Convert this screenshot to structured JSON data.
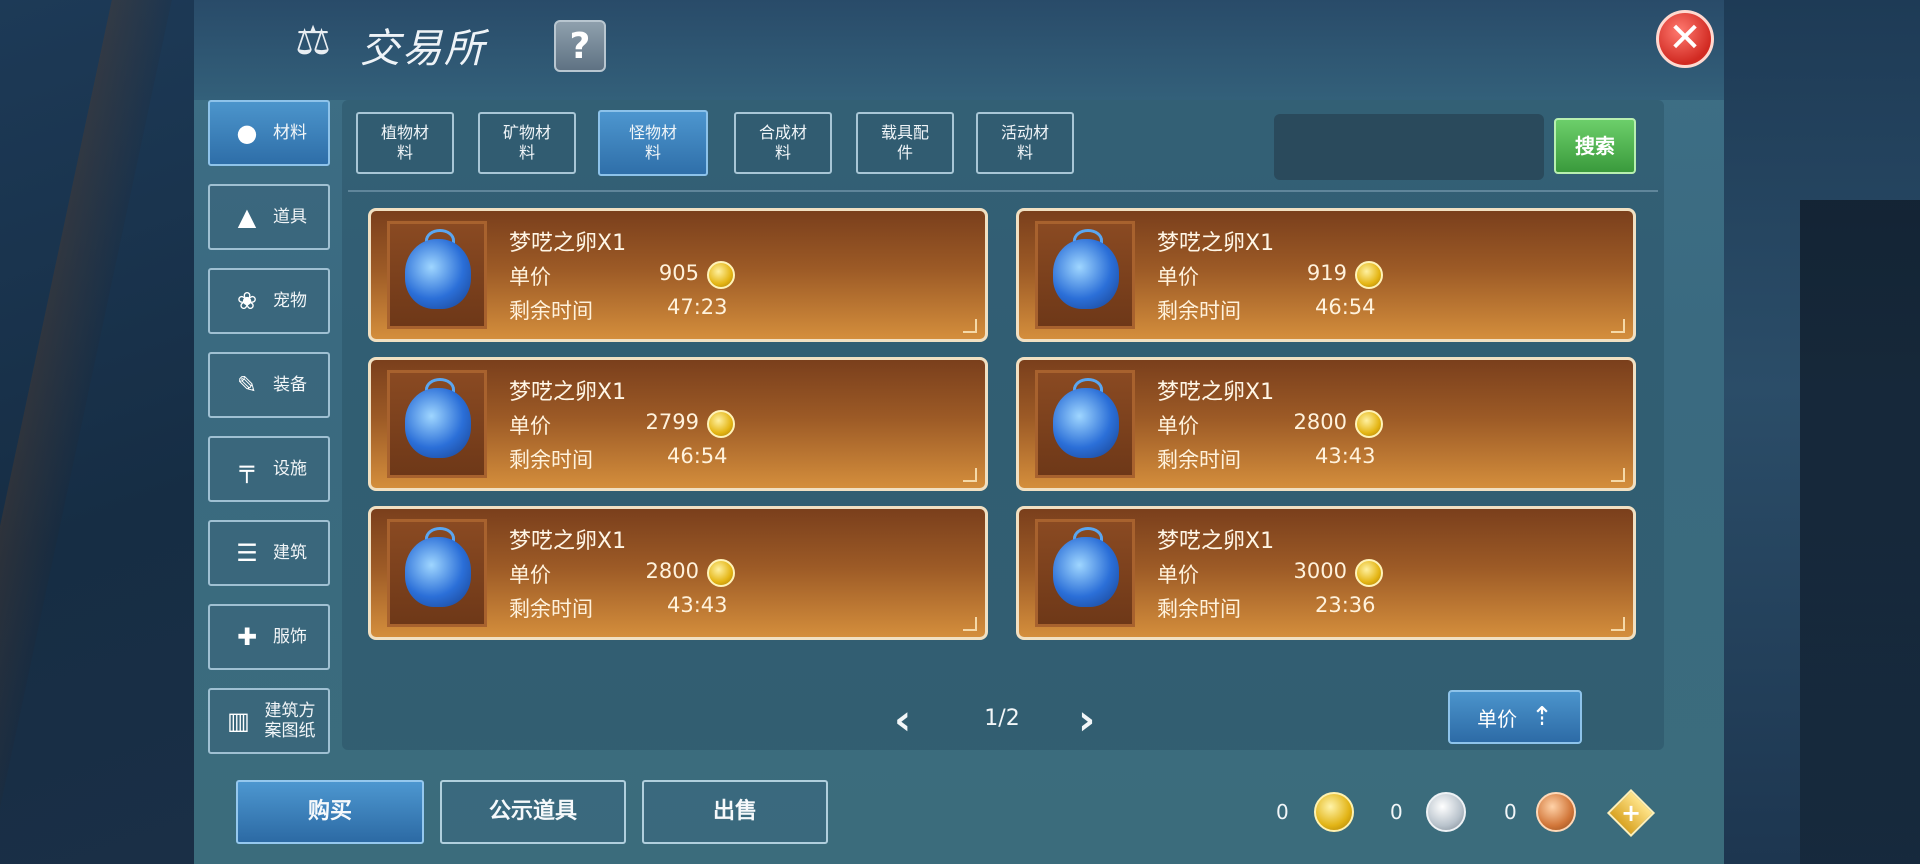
{
  "title": "交易所",
  "help_label": "?",
  "close_label": "✕",
  "sidebar": [
    {
      "label": "材料",
      "icon": "materials-icon",
      "glyph": "●"
    },
    {
      "label": "道具",
      "icon": "item-icon",
      "glyph": "▲"
    },
    {
      "label": "宠物",
      "icon": "paw-icon",
      "glyph": "❀"
    },
    {
      "label": "装备",
      "icon": "equipment-icon",
      "glyph": "✎"
    },
    {
      "label": "设施",
      "icon": "facility-icon",
      "glyph": "╤"
    },
    {
      "label": "建筑",
      "icon": "building-icon",
      "glyph": "☰"
    },
    {
      "label": "服饰",
      "icon": "clothing-icon",
      "glyph": "✚"
    },
    {
      "label": "建筑方案图纸",
      "label_lines": [
        "建筑方",
        "案图纸"
      ],
      "icon": "blueprint-icon",
      "glyph": "▥"
    }
  ],
  "active_sidebar": 0,
  "tabs": [
    {
      "l1": "植物材",
      "l2": "料"
    },
    {
      "l1": "矿物材",
      "l2": "料"
    },
    {
      "l1": "怪物材",
      "l2": "料"
    },
    {
      "l1": "合成材",
      "l2": "料"
    },
    {
      "l1": "载具配",
      "l2": "件"
    },
    {
      "l1": "活动材",
      "l2": "料"
    }
  ],
  "active_tab": 2,
  "search": {
    "value": "",
    "button_label": "搜索"
  },
  "listings": [
    {
      "name": "梦呓之卵X1",
      "price_label": "单价",
      "price": "905",
      "time_label": "剩余时间",
      "time": "47:23"
    },
    {
      "name": "梦呓之卵X1",
      "price_label": "单价",
      "price": "919",
      "time_label": "剩余时间",
      "time": "46:54"
    },
    {
      "name": "梦呓之卵X1",
      "price_label": "单价",
      "price": "2799",
      "time_label": "剩余时间",
      "time": "46:54"
    },
    {
      "name": "梦呓之卵X1",
      "price_label": "单价",
      "price": "2800",
      "time_label": "剩余时间",
      "time": "43:43"
    },
    {
      "name": "梦呓之卵X1",
      "price_label": "单价",
      "price": "2800",
      "time_label": "剩余时间",
      "time": "43:43"
    },
    {
      "name": "梦呓之卵X1",
      "price_label": "单价",
      "price": "3000",
      "time_label": "剩余时间",
      "time": "23:36"
    }
  ],
  "pager": {
    "text": "1/2",
    "prev": "‹",
    "next": "›"
  },
  "sort_button": {
    "label": "单价",
    "arrow": "⇡"
  },
  "bottom_buttons": {
    "buy": "购买",
    "public": "公示道具",
    "sell": "出售"
  },
  "currency": {
    "gold": "0",
    "silver": "0",
    "bronze": "0",
    "add": "+"
  },
  "colors": {
    "card_border": "#f1e0c2",
    "active_blue": "#2f6fa9",
    "search_green": "#3a9a3c",
    "close_red": "#d12a22"
  }
}
